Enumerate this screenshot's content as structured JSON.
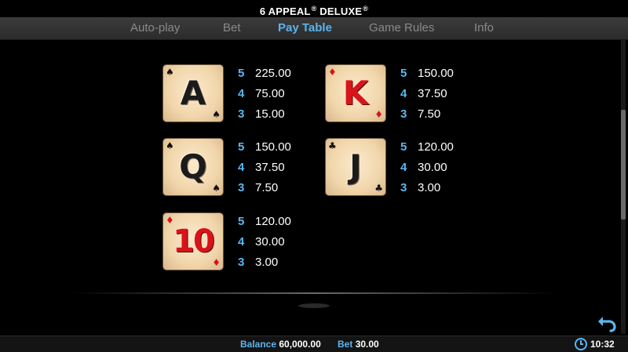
{
  "header": {
    "title": "6 APPEAL",
    "title_reg": "®",
    "title_suffix": "DELUXE",
    "title_mark": "®"
  },
  "tabs": [
    {
      "label": "Auto-play",
      "active": false
    },
    {
      "label": "Bet",
      "active": false
    },
    {
      "label": "Pay Table",
      "active": true
    },
    {
      "label": "Game Rules",
      "active": false
    },
    {
      "label": "Info",
      "active": false
    }
  ],
  "paytable": [
    {
      "symbol": "A",
      "suit": "♠",
      "color": "black",
      "pays": [
        {
          "count": "5",
          "value": "225.00"
        },
        {
          "count": "4",
          "value": "75.00"
        },
        {
          "count": "3",
          "value": "15.00"
        }
      ]
    },
    {
      "symbol": "K",
      "suit": "♦",
      "color": "red",
      "pays": [
        {
          "count": "5",
          "value": "150.00"
        },
        {
          "count": "4",
          "value": "37.50"
        },
        {
          "count": "3",
          "value": "7.50"
        }
      ]
    },
    {
      "symbol": "Q",
      "suit": "♠",
      "color": "black",
      "pays": [
        {
          "count": "5",
          "value": "150.00"
        },
        {
          "count": "4",
          "value": "37.50"
        },
        {
          "count": "3",
          "value": "7.50"
        }
      ]
    },
    {
      "symbol": "J",
      "suit": "♣",
      "color": "black",
      "pays": [
        {
          "count": "5",
          "value": "120.00"
        },
        {
          "count": "4",
          "value": "30.00"
        },
        {
          "count": "3",
          "value": "3.00"
        }
      ]
    },
    {
      "symbol": "10",
      "suit": "♦",
      "color": "red",
      "pays": [
        {
          "count": "5",
          "value": "120.00"
        },
        {
          "count": "4",
          "value": "30.00"
        },
        {
          "count": "3",
          "value": "3.00"
        }
      ]
    }
  ],
  "footer": {
    "balance_label": "Balance",
    "balance_value": "60,000.00",
    "bet_label": "Bet",
    "bet_value": "30.00",
    "clock_time": "10:32"
  },
  "colors": {
    "accent": "#5cb6f0",
    "card_red": "#d8141a",
    "tab_inactive": "#8a8a8a"
  },
  "icons": {
    "back": "undo-arrow-icon",
    "clock": "clock-icon"
  }
}
